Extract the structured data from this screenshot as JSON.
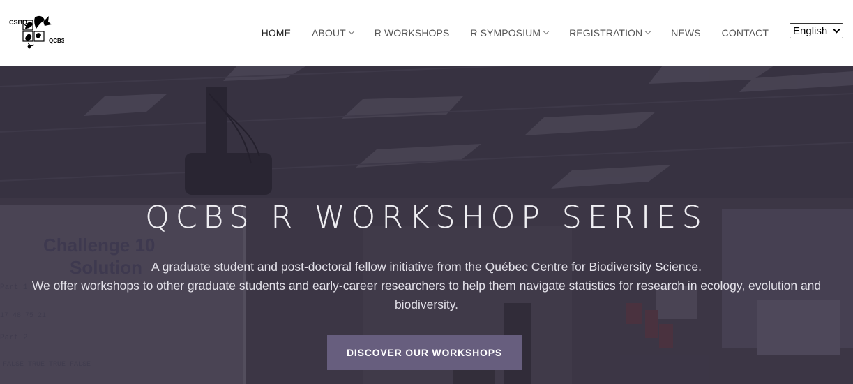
{
  "header": {
    "logo": {
      "text_top": "CSBQ",
      "text_bottom": "QCBS"
    },
    "nav": [
      {
        "label": "HOME",
        "has_dropdown": false,
        "active": true
      },
      {
        "label": "ABOUT",
        "has_dropdown": true,
        "active": false
      },
      {
        "label": "R WORKSHOPS",
        "has_dropdown": false,
        "active": false
      },
      {
        "label": "R SYMPOSIUM",
        "has_dropdown": true,
        "active": false
      },
      {
        "label": "REGISTRATION",
        "has_dropdown": true,
        "active": false
      },
      {
        "label": "NEWS",
        "has_dropdown": false,
        "active": false
      },
      {
        "label": "CONTACT",
        "has_dropdown": false,
        "active": false
      }
    ],
    "language": {
      "selected": "English"
    }
  },
  "hero": {
    "title": "QCBS R WORKSHOP SERIES",
    "line1": "A graduate student and post-doctoral fellow initiative from the Québec Centre for Biodiversity Science.",
    "line2": "We offer workshops to other graduate students and early-career researchers to help them navigate statistics for research in ecology, evolution and biodiversity.",
    "cta_label": "DISCOVER OUR WORKSHOPS",
    "background_slide": {
      "title_line1": "Challenge 10",
      "title_line2": "Solution",
      "lines": [
        "Part 1",
        "17 48 75 21",
        "Part 2",
        "FALSE TRUE TRUE FALSE"
      ]
    }
  },
  "colors": {
    "nav_text": "#555555",
    "nav_active": "#222222",
    "cta_background": "#675e7e",
    "hero_overlay": "#3c3946"
  }
}
